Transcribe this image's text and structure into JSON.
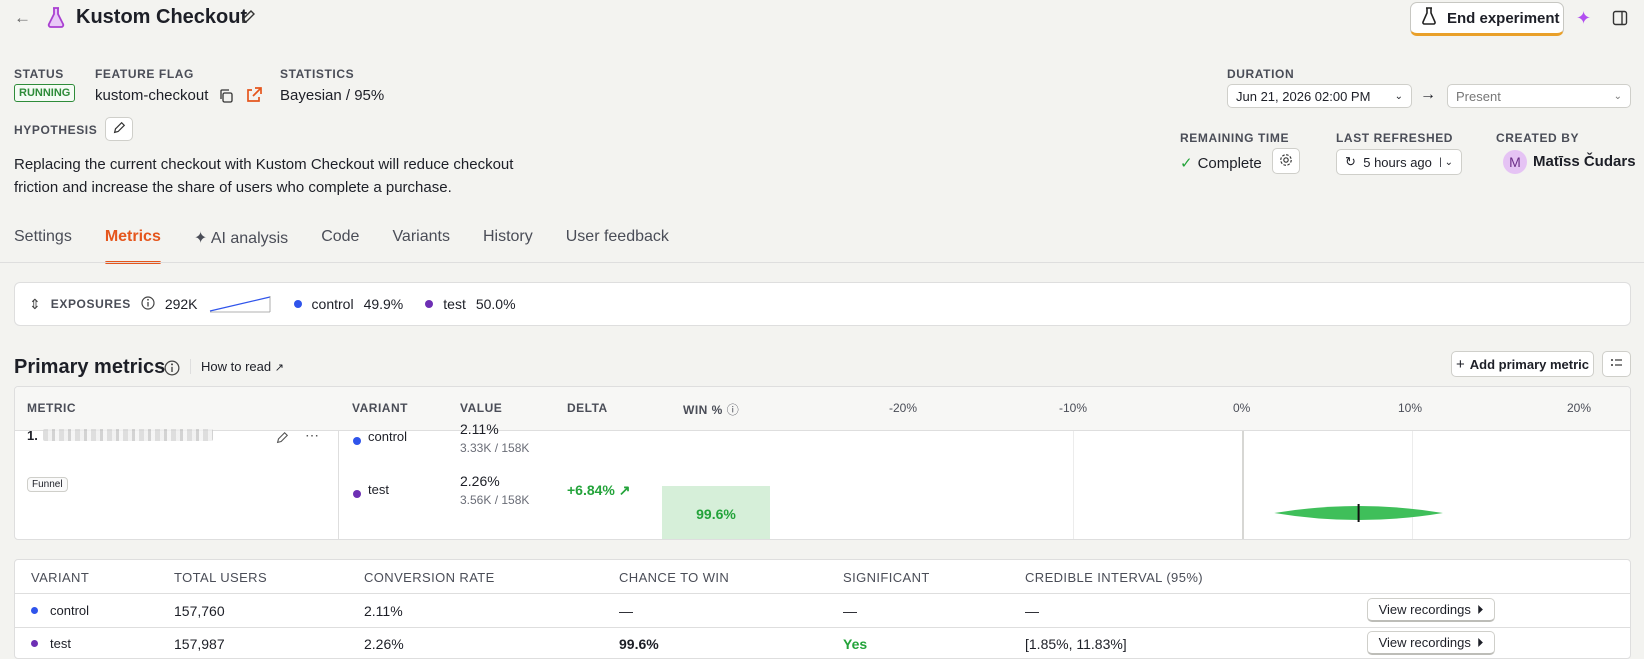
{
  "header": {
    "back_glyph": "←",
    "title": "Kustom Checkout",
    "end_button": "End experiment"
  },
  "meta": {
    "status_label": "STATUS",
    "status_value": "RUNNING",
    "flag_label": "FEATURE FLAG",
    "flag_value": "kustom-checkout",
    "stats_label": "STATISTICS",
    "stats_value": "Bayesian / 95%",
    "hypothesis_label": "HYPOTHESIS",
    "hypothesis_text": "Replacing the current checkout with Kustom Checkout will reduce checkout friction and increase the share of users who complete a purchase.",
    "duration_label": "DURATION",
    "duration_start": "Jun 21, 2026 02:00 PM",
    "duration_end": "Present",
    "remaining_label": "REMAINING TIME",
    "remaining_value": "Complete",
    "refreshed_label": "LAST REFRESHED",
    "refreshed_value": "5 hours ago",
    "created_label": "CREATED BY",
    "creator_initial": "M",
    "creator_name": "Matīss Čudars"
  },
  "tabs": [
    {
      "label": "Settings"
    },
    {
      "label": "Metrics"
    },
    {
      "label": "AI analysis"
    },
    {
      "label": "Code"
    },
    {
      "label": "Variants"
    },
    {
      "label": "History"
    },
    {
      "label": "User feedback"
    }
  ],
  "exposures": {
    "label": "EXPOSURES",
    "total": "292K",
    "control_name": "control",
    "control_pct": "49.9%",
    "test_name": "test",
    "test_pct": "50.0%"
  },
  "primary": {
    "title": "Primary metrics",
    "how_to_read": "How to read",
    "add_button": "Add primary metric",
    "headers": {
      "metric": "METRIC",
      "variant": "VARIANT",
      "value": "VALUE",
      "delta": "DELTA",
      "win": "WIN %"
    },
    "ticks": [
      "-20%",
      "-10%",
      "0%",
      "10%",
      "20%"
    ],
    "metric_index": "1.",
    "metric_tag": "Funnel",
    "rows": [
      {
        "variant": "control",
        "value": "2.11%",
        "sub": "3.33K / 158K"
      },
      {
        "variant": "test",
        "value": "2.26%",
        "sub": "3.56K / 158K",
        "delta": "+6.84%",
        "win": "99.6%"
      }
    ],
    "interval": {
      "low": 1.85,
      "high": 11.83,
      "point": 6.84
    }
  },
  "results": {
    "headers": [
      "VARIANT",
      "TOTAL USERS",
      "CONVERSION RATE",
      "CHANCE TO WIN",
      "SIGNIFICANT",
      "CREDIBLE INTERVAL (95%)"
    ],
    "view_recordings": "View recordings",
    "rows": [
      {
        "variant": "control",
        "users": "157,760",
        "rate": "2.11%",
        "chance": "—",
        "sig": "—",
        "ci": "—"
      },
      {
        "variant": "test",
        "users": "157,987",
        "rate": "2.26%",
        "chance": "99.6%",
        "sig": "Yes",
        "ci": "[1.85%, 11.83%]"
      }
    ]
  },
  "colors": {
    "accent": "#e5561d",
    "control": "#2f54eb",
    "test": "#6d2fb4",
    "positive": "#23a33a"
  }
}
